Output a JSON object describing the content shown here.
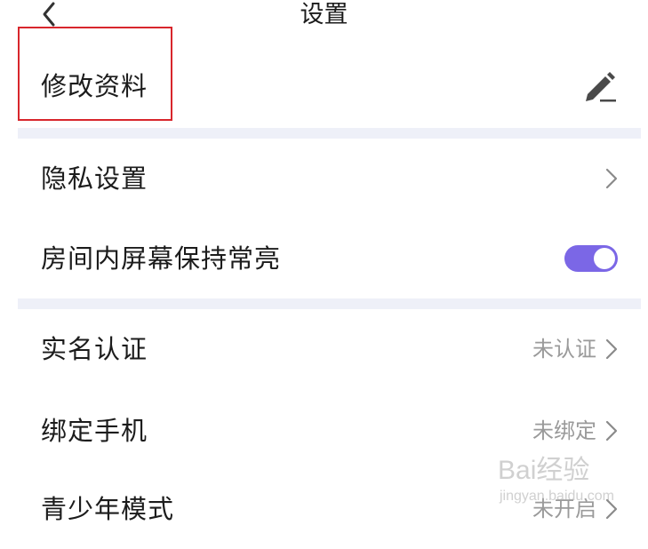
{
  "header": {
    "title": "设置",
    "back_icon": "chevron-left-icon"
  },
  "rows": [
    {
      "label": "修改资料",
      "icon": "pencil-icon",
      "highlighted": true
    },
    {
      "label": "隐私设置",
      "icon": "chevron-right-icon"
    },
    {
      "label": "房间内屏幕保持常亮",
      "toggle_on": true
    },
    {
      "label": "实名认证",
      "value": "未认证",
      "icon": "chevron-right-icon"
    },
    {
      "label": "绑定手机",
      "value": "未绑定",
      "icon": "chevron-right-icon"
    },
    {
      "label": "青少年模式",
      "value": "未开启",
      "icon": "chevron-right-icon"
    }
  ],
  "colors": {
    "accent": "#7b67e6",
    "highlight_border": "#d8262c",
    "secondary_text": "#9a9a9a",
    "divider_band": "#eef0f8"
  },
  "watermark": {
    "logo": "Bai经验",
    "url": "jingyan.baidu.com"
  }
}
